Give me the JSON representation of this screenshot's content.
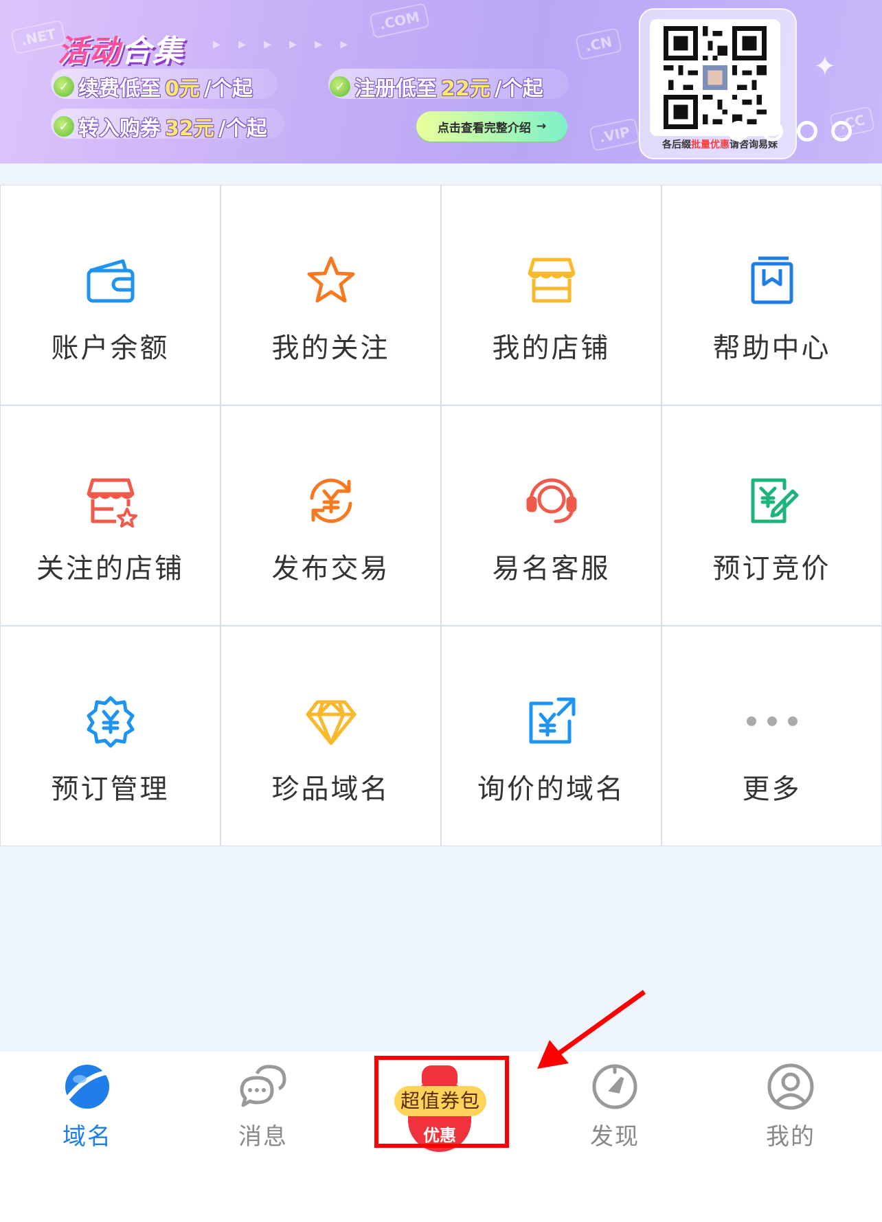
{
  "banner": {
    "title_part1": "活动",
    "title_part2": "合集",
    "tld_decor": [
      ".NET",
      ".COM",
      ".CN",
      ".VIP",
      ".CC"
    ],
    "promos": [
      {
        "pre": "续费低至",
        "hl": "0元",
        "post": "/个起"
      },
      {
        "pre": "注册低至",
        "hl": "22元",
        "post": "/个起"
      },
      {
        "pre": "转入购券",
        "hl": "32元",
        "post": "/个起"
      }
    ],
    "cta_label": "点击查看完整介绍",
    "cta_arrow": "→",
    "qr_caption_pre": "各后缀",
    "qr_caption_red": "批量优惠",
    "qr_caption_post": "请咨询易妹",
    "carousel_count": 4,
    "carousel_active": 1
  },
  "grid": [
    {
      "label": "账户余额",
      "icon": "wallet-icon"
    },
    {
      "label": "我的关注",
      "icon": "star-icon"
    },
    {
      "label": "我的店铺",
      "icon": "store-icon"
    },
    {
      "label": "帮助中心",
      "icon": "help-book-icon"
    },
    {
      "label": "关注的店铺",
      "icon": "store-star-icon"
    },
    {
      "label": "发布交易",
      "icon": "yuan-exchange-icon"
    },
    {
      "label": "易名客服",
      "icon": "headset-icon"
    },
    {
      "label": "预订竞价",
      "icon": "bid-edit-icon"
    },
    {
      "label": "预订管理",
      "icon": "yuan-gear-icon"
    },
    {
      "label": "珍品域名",
      "icon": "diamond-icon"
    },
    {
      "label": "询价的域名",
      "icon": "yuan-share-icon"
    },
    {
      "label": "更多",
      "icon": "more-dots-icon"
    }
  ],
  "colors": {
    "blue": "#1f93f0",
    "orange": "#f7781e",
    "yellow": "#f9b92c",
    "red": "#f05a4a",
    "green": "#1eb37a",
    "grey": "#aaaaaa",
    "tab_active": "#1f7ee8"
  },
  "tabs": {
    "domain": "域名",
    "messages": "消息",
    "coupon_top": "超值券包",
    "coupon_bottom": "优惠",
    "discover": "发现",
    "mine": "我的"
  }
}
